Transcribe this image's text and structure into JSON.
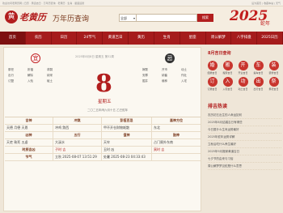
{
  "topbar": {
    "left": "欢迎访问老黄历网 | 日历 · 黄道吉日 · 万年历查询 · 老黄历 · 生肖 · 星座运势",
    "right": "设为首页 | 收藏本站 | 天气"
  },
  "header": {
    "logo_char": "黄",
    "logo_text": "老黄历",
    "site_title": "万年历查询",
    "search_select": "全部",
    "search_placeholder": "",
    "search_button": "搜索",
    "brand_year": "2025",
    "brand_deco": "蛇年"
  },
  "nav": [
    "首页",
    "农历",
    "日历",
    "24节气",
    "黄道吉日",
    "黄历",
    "生肖",
    "星座",
    "周公解梦",
    "八字排盘",
    "2025日历"
  ],
  "main": {
    "yi_seal": "宜",
    "ji_seal": "忌",
    "yi_items": [
      "祭祀",
      "祈福",
      "求嗣",
      "出行",
      "解除",
      "纳采",
      "订盟",
      "入殓",
      "破土"
    ],
    "ji_items": [
      "嫁娶",
      "开市",
      "动土",
      "安葬",
      "纳畜",
      "作灶",
      "掘井",
      "栽种",
      "入宅"
    ],
    "date_line": "2025年8月8日 星期五 第32周",
    "day": "8",
    "weekday": "星期五",
    "lunar": "二〇二五年闰六月十五 乙巳蛇年",
    "table": [
      [
        "吉神",
        "冲煞",
        "彭祖百忌",
        "喜神方位"
      ],
      [
        "天德 月德 天恩",
        "冲鸡 煞西",
        "甲不开仓财物耗散",
        "东北"
      ],
      [
        "凶神",
        "五行",
        "值神",
        "胎神"
      ],
      [
        "天吏 致死 五虚",
        "大溪水",
        "天牢",
        "占门厕外东南"
      ],
      [
        "时辰吉凶",
        "子时 吉",
        "丑时 凶",
        "寅时 吉"
      ],
      [
        "节气",
        "立秋 2025-08-07 13:51:29",
        "处暑 2025-08-23 04:33:43",
        ""
      ]
    ]
  },
  "side": {
    "tools_title": "8月吉日查询",
    "tiles": [
      {
        "icon": "婚",
        "label": "结婚吉日"
      },
      {
        "icon": "搬",
        "label": "搬家吉日"
      },
      {
        "icon": "开",
        "label": "开业吉日"
      },
      {
        "icon": "车",
        "label": "提车吉日"
      },
      {
        "icon": "装",
        "label": "装修吉日"
      },
      {
        "icon": "订",
        "label": "订婚吉日"
      },
      {
        "icon": "入",
        "label": "入宅吉日"
      },
      {
        "icon": "动",
        "label": "动土吉日"
      },
      {
        "icon": "出",
        "label": "出行吉日"
      },
      {
        "icon": "祭",
        "label": "祭祀吉日"
      }
    ],
    "hot_title": "排吉热读",
    "hot_items": [
      "农历初五出生的人命运如何",
      "2025年8月结婚吉日有哪些",
      "今日属什么生肖运势最好",
      "2025年蛇年运势详解",
      "立秋后吃什么养生最好",
      "2025年9月搬家黄道吉日",
      "七夕节的由来与习俗",
      "周公解梦梦见蛇是什么意思"
    ]
  }
}
